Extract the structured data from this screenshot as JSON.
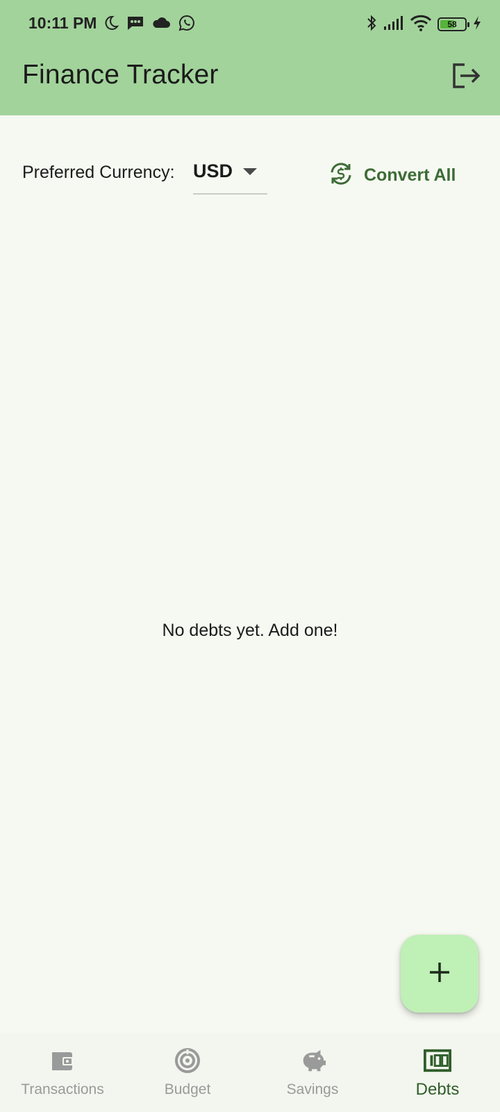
{
  "status_bar": {
    "time": "10:11 PM",
    "battery_level": "58",
    "battery_fraction": 0.58,
    "left_icons": [
      "moon-icon",
      "message-icon",
      "cloud-icon",
      "whatsapp-icon"
    ],
    "right_icons": [
      "bluetooth-icon",
      "signal-icon",
      "wifi-icon",
      "battery-icon",
      "charging-icon"
    ]
  },
  "header": {
    "title": "Finance Tracker",
    "action_icon": "logout-icon"
  },
  "currency": {
    "label": "Preferred Currency:",
    "selected": "USD",
    "convert_label": "Convert All",
    "convert_icon": "currency-exchange-icon"
  },
  "main": {
    "empty_message": "No debts yet. Add one!"
  },
  "fab": {
    "icon": "plus-icon"
  },
  "bottom_nav": {
    "items": [
      {
        "label": "Transactions",
        "icon": "wallet-icon",
        "active": false
      },
      {
        "label": "Budget",
        "icon": "donut-chart-icon",
        "active": false
      },
      {
        "label": "Savings",
        "icon": "piggy-bank-icon",
        "active": false
      },
      {
        "label": "Debts",
        "icon": "money-bill-icon",
        "active": true
      }
    ]
  },
  "colors": {
    "appbar": "#a2d39b",
    "background": "#f6f9f1",
    "accent": "#3c6b36",
    "fab": "#bff0b6",
    "inactive_nav": "#9a9a9a",
    "battery_fill": "#56b33b"
  }
}
